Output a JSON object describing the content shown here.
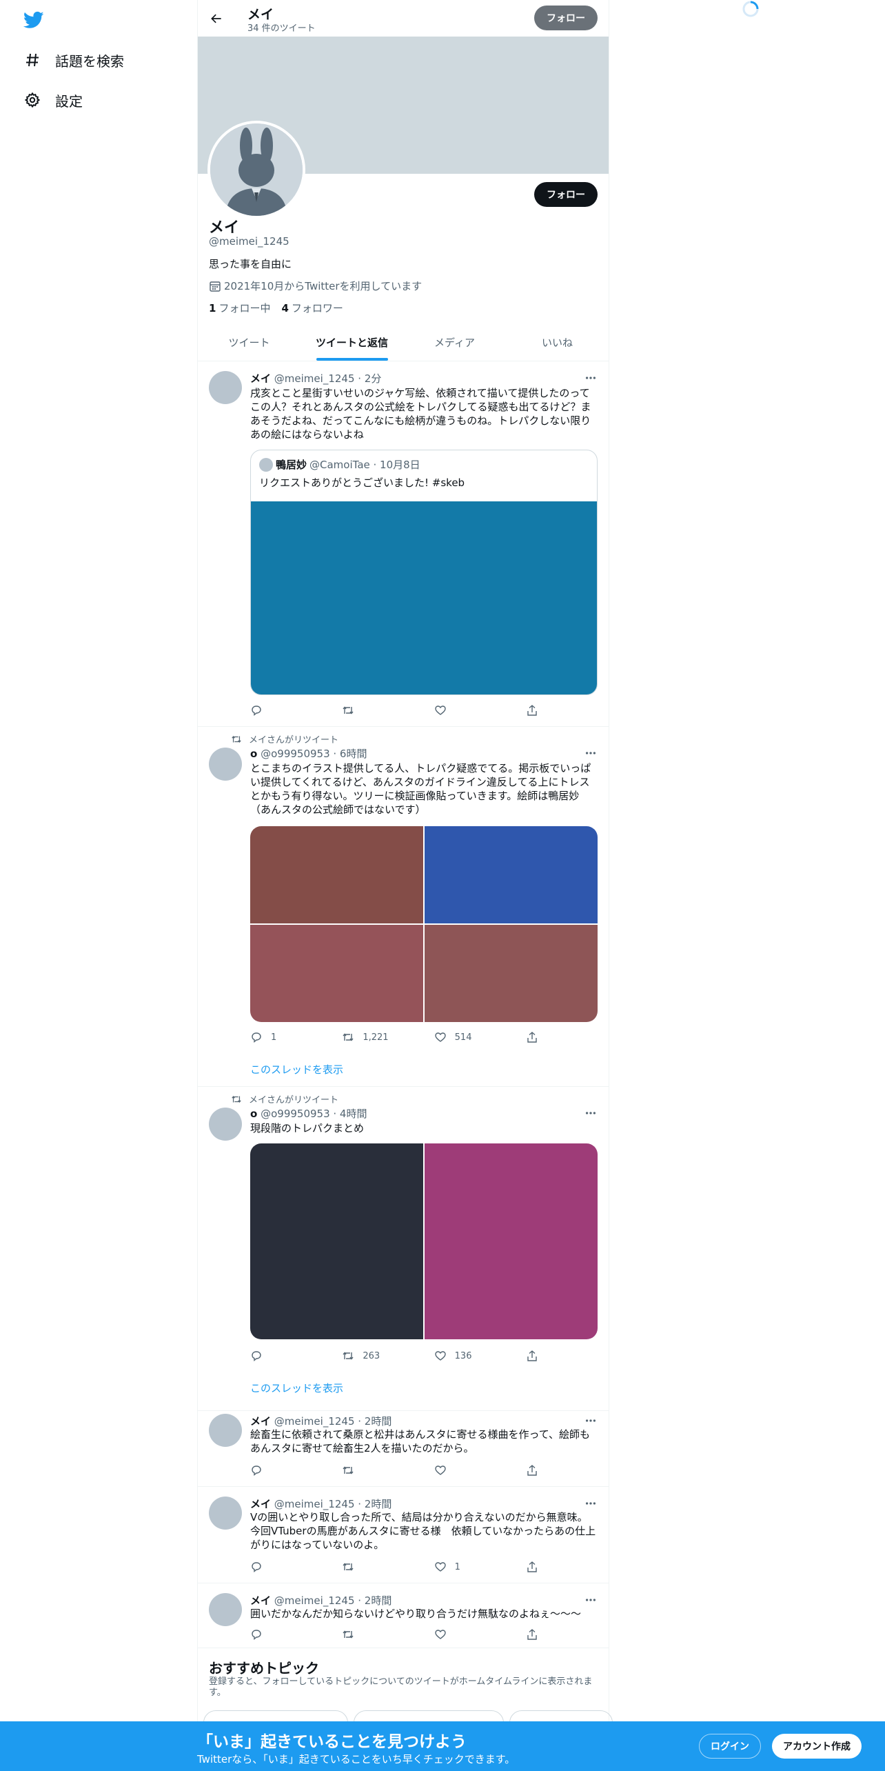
{
  "nav": {
    "logo_icon": "twitter-bird-icon",
    "items": [
      {
        "icon": "hashtag-icon",
        "label": "話題を検索"
      },
      {
        "icon": "gear-icon",
        "label": "設定"
      }
    ]
  },
  "header": {
    "name": "メイ",
    "tweet_count": "34 件のツイート",
    "follow_label": "フォロー"
  },
  "profile": {
    "name": "メイ",
    "handle": "@meimei_1245",
    "bio": "思った事を自由に",
    "joined": "2021年10月からTwitterを利用しています",
    "following_count": "1",
    "following_label": "フォロー中",
    "followers_count": "4",
    "followers_label": "フォロワー",
    "follow_label": "フォロー"
  },
  "tabs": [
    "ツイート",
    "ツイートと返信",
    "メディア",
    "いいね"
  ],
  "tweets": [
    {
      "name": "メイ",
      "meta": "@meimei_1245 · 2分",
      "text": "戌亥とこと星街すいせいのジャケ写絵、依頼されて描いて提供したのってこの人？それとあんスタの公式絵をトレパクしてる疑惑も出てるけど？まあそうだよね、だってこんなにも絵柄が違うものね。トレパクしない限りあの絵にはならないよね",
      "quote": {
        "name": "鴨居妙",
        "meta": "@CamoiTae · 10月8日",
        "text": "リクエストありがとうございました! #skeb"
      }
    },
    {
      "retweet_label": "メイさんがリツイート",
      "name": "o",
      "meta": "@o99950953 · 6時間",
      "text": "とこまちのイラスト提供してる人、トレパク疑惑でてる。掲示板でいっぱい提供してくれてるけど、あんスタのガイドライン違反してる上にトレスとかもう有り得ない。ツリーに検証画像貼っていきます。絵師は鴨居妙（あんスタの公式絵師ではないです）",
      "replies": "1",
      "retweets": "1,221",
      "likes": "514",
      "thread_label": "このスレッドを表示"
    },
    {
      "retweet_label": "メイさんがリツイート",
      "name": "o",
      "meta": "@o99950953 · 4時間",
      "text": "現段階のトレパクまとめ",
      "replies": "",
      "retweets": "263",
      "likes": "136",
      "thread_label": "このスレッドを表示"
    },
    {
      "name": "メイ",
      "meta": "@meimei_1245 · 2時間",
      "text": "絵畜生に依頼されて桑原と松井はあんスタに寄せる様曲を作って、絵師もあんスタに寄せて絵畜生2人を描いたのだから。"
    },
    {
      "name": "メイ",
      "meta": "@meimei_1245 · 2時間",
      "text": "Vの囲いとやり取し合った所で、結局は分かり合えないのだから無意味。今回VTuberの馬鹿があんスタに寄せる様　依頼していなかったらあの仕上がりにはなっていないのよ。",
      "likes": "1"
    },
    {
      "name": "メイ",
      "meta": "@meimei_1245 · 2時間",
      "text": "囲いだかなんだか知らないけどやり取り合うだけ無駄なのよねぇ～～～"
    }
  ],
  "topics": {
    "title": "おすすめトピック",
    "subtitle": "登録すると、フォローしているトピックについてのツイートがホームタイムラインに表示されます。"
  },
  "bottom_bar": {
    "title": "「いま」起きていることを見つけよう",
    "subtitle": "Twitterなら、「いま」起きていることをいち早くチェックできます。",
    "login_label": "ログイン",
    "signup_label": "アカウント作成"
  },
  "colors": {
    "accent": "#1d9bf0",
    "banner": "#cfd9de",
    "quote_image": "#137aa8",
    "tweet2_images": [
      "#844d48",
      "#2f57ad",
      "#955359",
      "#8e5556"
    ],
    "tweet3_images": [
      "#292e3a",
      "#9e3c78"
    ]
  }
}
